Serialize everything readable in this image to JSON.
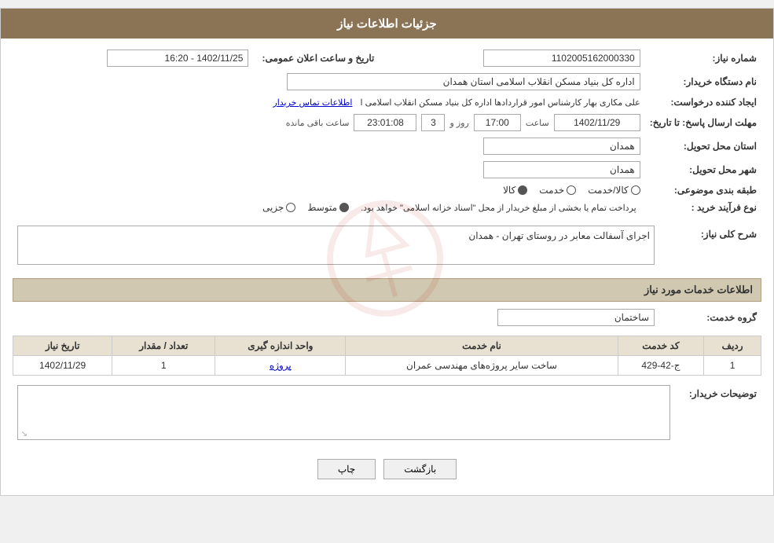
{
  "page": {
    "title": "جزئیات اطلاعات نیاز"
  },
  "header": {
    "date_label": "تاریخ و ساعت اعلان عمومی:",
    "date_value": "1402/11/25 - 16:20",
    "need_number_label": "شماره نیاز:",
    "need_number_value": "1102005162000330",
    "buyer_org_label": "نام دستگاه خریدار:",
    "buyer_org_value": "اداره کل بنیاد مسکن انقلاب اسلامی استان همدان",
    "creator_label": "ایجاد کننده درخواست:",
    "creator_value": "علی مکاری بهار کارشناس امور قراردادها اداره کل بنیاد مسکن انقلاب اسلامی ا",
    "contact_link": "اطلاعات تماس خریدار",
    "deadline_label": "مهلت ارسال پاسخ: تا تاریخ:",
    "deadline_date": "1402/11/29",
    "deadline_time_label": "ساعت",
    "deadline_time": "17:00",
    "deadline_day_label": "روز و",
    "deadline_days": "3",
    "deadline_remaining_label": "ساعت باقی مانده",
    "deadline_remaining": "23:01:08",
    "province_label": "استان محل تحویل:",
    "province_value": "همدان",
    "city_label": "شهر محل تحویل:",
    "city_value": "همدان",
    "category_label": "طبقه بندی موضوعی:",
    "category_options": [
      "کالا",
      "خدمت",
      "کالا/خدمت"
    ],
    "category_selected": "کالا",
    "process_label": "نوع فرآیند خرید :",
    "process_options": [
      "جزیی",
      "متوسط"
    ],
    "process_note": "پرداخت تمام یا بخشی از مبلغ خریدار از محل \"اسناد خزانه اسلامی\" خواهد بود.",
    "need_description_label": "شرح کلی نیاز:",
    "need_description_value": "اجرای آسفالت معابر در روستای تهران - همدان",
    "services_section_label": "اطلاعات خدمات مورد نیاز",
    "service_group_label": "گروه خدمت:",
    "service_group_value": "ساختمان",
    "table_headers": {
      "row_num": "ردیف",
      "service_code": "کد خدمت",
      "service_name": "نام خدمت",
      "unit": "واحد اندازه گیری",
      "quantity": "تعداد / مقدار",
      "need_date": "تاریخ نیاز"
    },
    "table_rows": [
      {
        "row_num": "1",
        "service_code": "ج-42-429",
        "service_name": "ساخت سایر پروژه‌های مهندسی عمران",
        "unit": "پروژه",
        "quantity": "1",
        "need_date": "1402/11/29"
      }
    ],
    "buyer_notes_label": "توضیحات خریدار:",
    "btn_back": "بازگشت",
    "btn_print": "چاپ"
  }
}
